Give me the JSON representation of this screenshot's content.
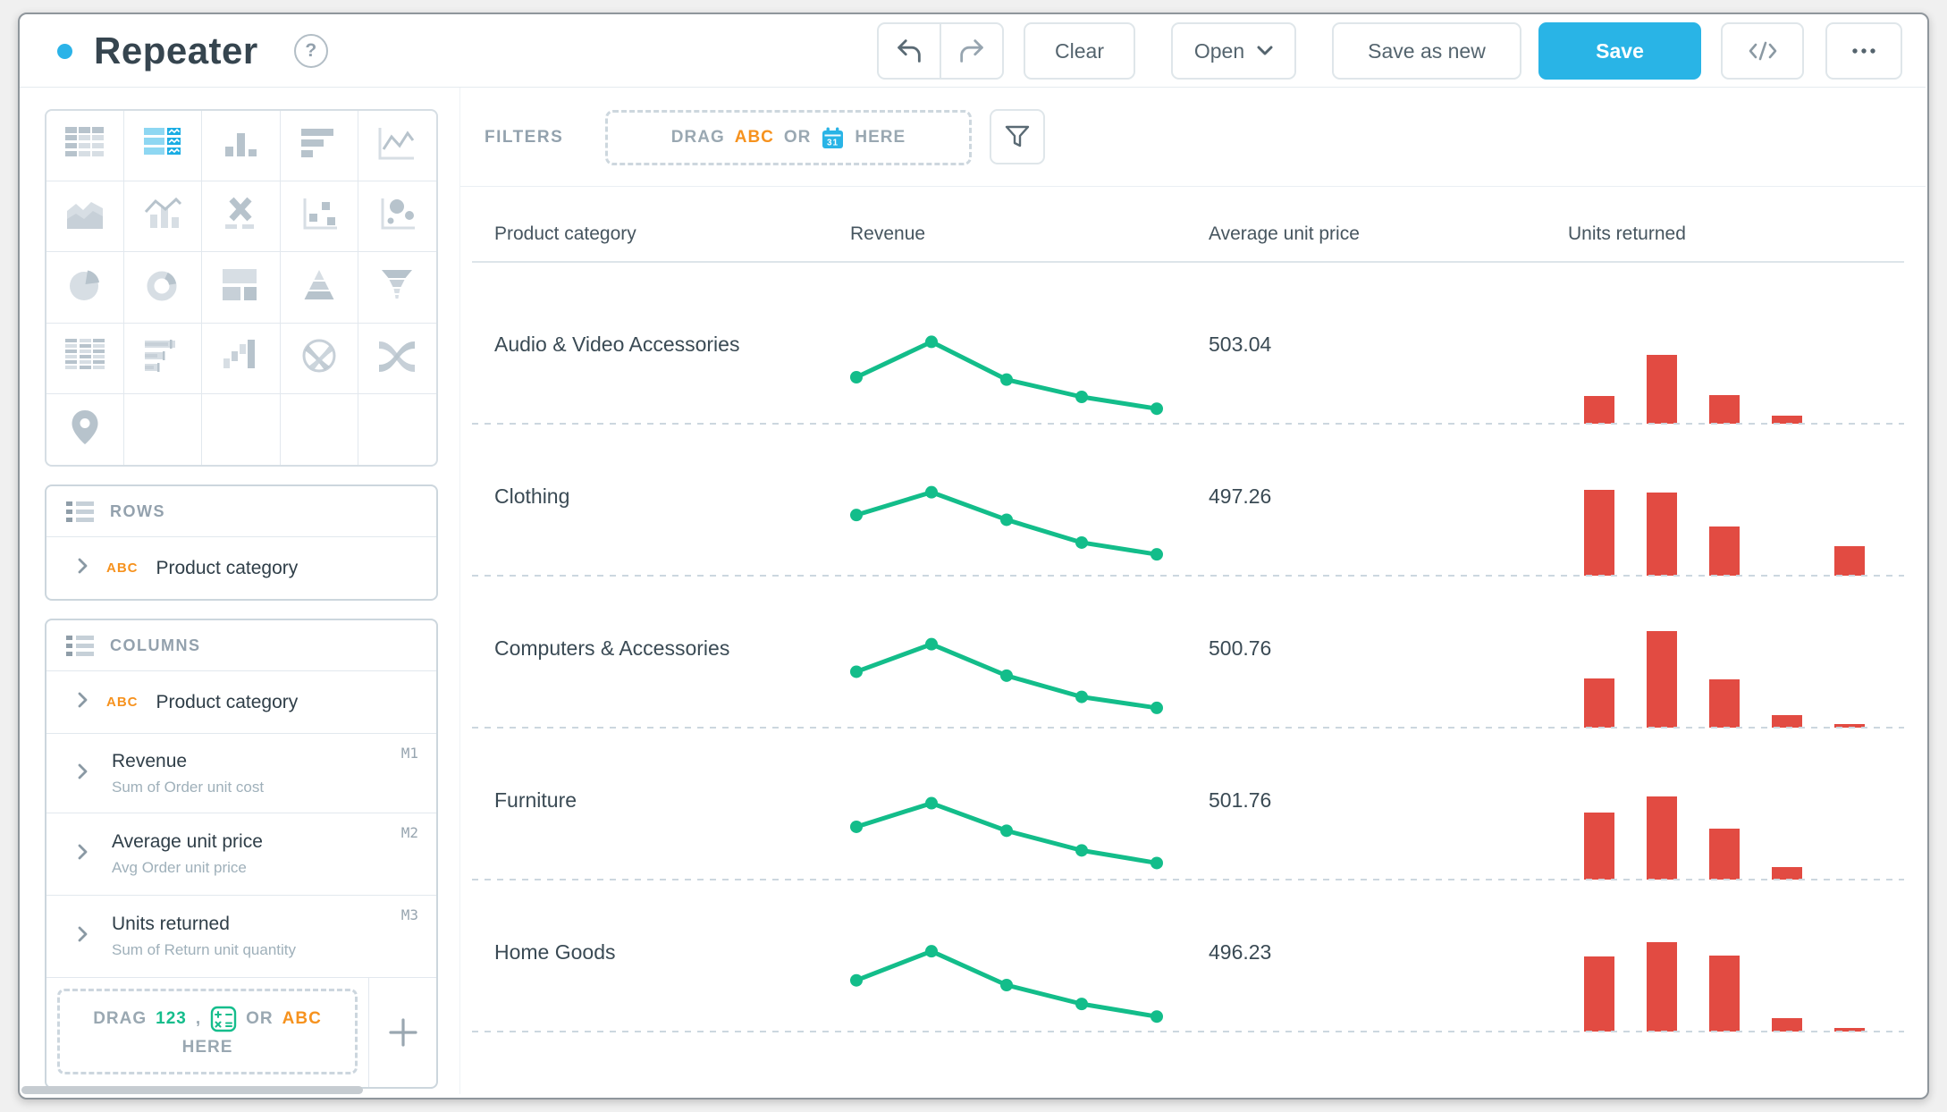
{
  "header": {
    "title": "Repeater"
  },
  "toolbar": {
    "clear_label": "Clear",
    "open_label": "Open",
    "save_as_new_label": "Save as new",
    "save_label": "Save"
  },
  "chart_picker": {
    "selected": "repeater",
    "icons": [
      "table",
      "repeater",
      "column-chart",
      "bar-chart",
      "line-chart",
      "area-chart",
      "combo-chart",
      "text-chart",
      "scatter-plot",
      "bubble-chart",
      "pie-chart",
      "donut-chart",
      "treemap",
      "pyramid-chart",
      "funnel-chart",
      "pivot-table",
      "bullet-chart",
      "waterfall-chart",
      "chord-diagram",
      "sankey-diagram",
      "map-chart",
      "",
      "",
      "",
      ""
    ]
  },
  "shelves": {
    "rows": {
      "title": "ROWS",
      "items": [
        {
          "kind": "dimension",
          "field_type": "ABC",
          "label": "Product category"
        }
      ]
    },
    "columns": {
      "title": "COLUMNS",
      "items": [
        {
          "kind": "dimension",
          "field_type": "ABC",
          "label": "Product category"
        },
        {
          "kind": "measure",
          "label": "Revenue",
          "badge": "M1",
          "sublabel": "Sum of Order unit cost"
        },
        {
          "kind": "measure",
          "label": "Average unit price",
          "badge": "M2",
          "sublabel": "Avg Order unit price"
        },
        {
          "kind": "measure",
          "label": "Units returned",
          "badge": "M3",
          "sublabel": "Sum of Return unit quantity"
        }
      ]
    },
    "drop_zone": {
      "drag": "DRAG",
      "number_token": "123",
      "comma": ",",
      "or": "OR",
      "text_token": "ABC",
      "here": "HERE"
    }
  },
  "filters": {
    "label": "FILTERS",
    "drag": "DRAG",
    "text_token": "ABC",
    "or": "OR",
    "here": "HERE"
  },
  "table": {
    "headers": [
      "Product category",
      "Revenue",
      "Average unit price",
      "Units returned"
    ],
    "rows": [
      {
        "category": "Audio & Video Accessories",
        "average_unit_price": "503.04",
        "revenue_spark": [
          0.5,
          0.95,
          0.47,
          0.25,
          0.1
        ],
        "units_returned_bars": [
          0.29,
          0.71,
          0.3,
          0.08,
          0
        ]
      },
      {
        "category": "Clothing",
        "average_unit_price": "497.26",
        "revenue_spark": [
          0.68,
          0.97,
          0.62,
          0.33,
          0.18
        ],
        "units_returned_bars": [
          0.89,
          0.86,
          0.51,
          0,
          0.31
        ]
      },
      {
        "category": "Computers & Accessories",
        "average_unit_price": "500.76",
        "revenue_spark": [
          0.62,
          0.97,
          0.57,
          0.3,
          0.16
        ],
        "units_returned_bars": [
          0.51,
          1.0,
          0.5,
          0.13,
          0.04
        ]
      },
      {
        "category": "Furniture",
        "average_unit_price": "501.76",
        "revenue_spark": [
          0.58,
          0.88,
          0.53,
          0.28,
          0.12
        ],
        "units_returned_bars": [
          0.69,
          0.86,
          0.53,
          0.13,
          0
        ]
      },
      {
        "category": "Home Goods",
        "average_unit_price": "496.23",
        "revenue_spark": [
          0.56,
          0.93,
          0.5,
          0.26,
          0.1
        ],
        "units_returned_bars": [
          0.78,
          0.93,
          0.79,
          0.14,
          0.04
        ]
      }
    ]
  },
  "colors": {
    "accent_blue": "#29b4e6",
    "spark_green": "#13bd8a",
    "bar_red": "#e24b42",
    "abc_orange": "#f6921e",
    "num_green": "#15bd8c"
  }
}
